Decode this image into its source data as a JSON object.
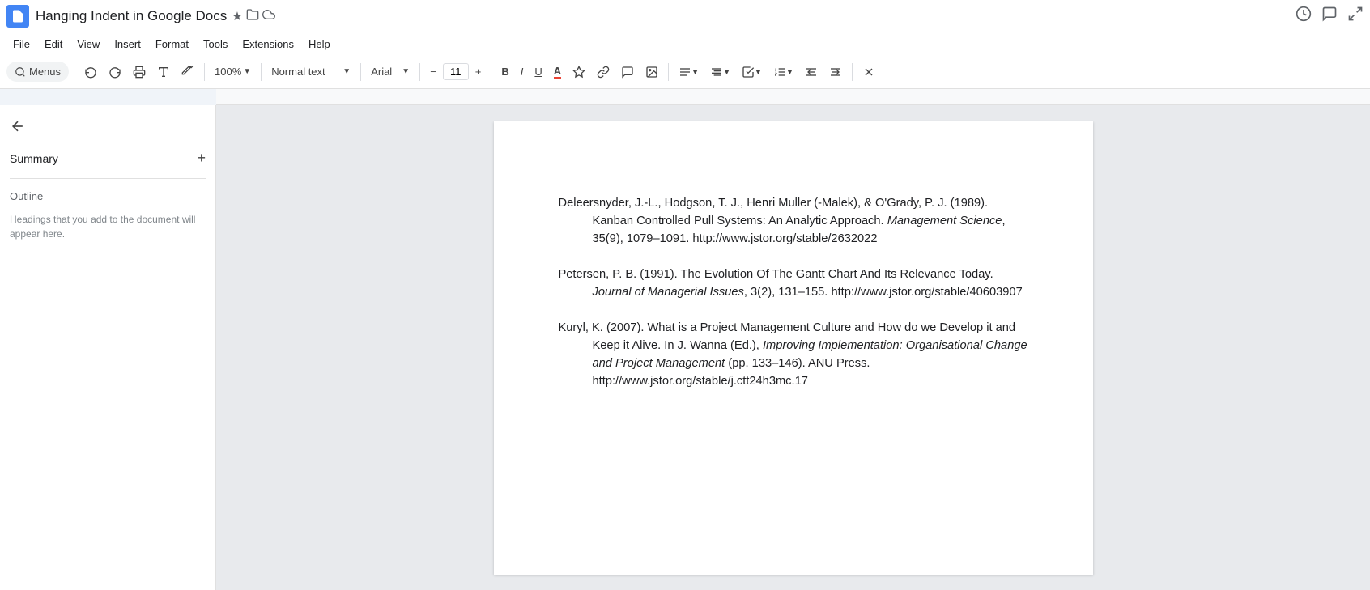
{
  "app": {
    "title": "Hanging Indent in Google Docs",
    "icon_color": "#4285f4"
  },
  "topbar": {
    "title": "Hanging Indent in Google Docs",
    "star_icon": "★",
    "folder_icon": "📁",
    "cloud_icon": "☁",
    "history_icon": "⏱",
    "comment_icon": "💬",
    "expand_icon": "⛶"
  },
  "menubar": {
    "items": [
      "File",
      "Edit",
      "View",
      "Insert",
      "Format",
      "Tools",
      "Extensions",
      "Help"
    ]
  },
  "toolbar": {
    "menus_label": "Menus",
    "undo_icon": "↩",
    "redo_icon": "↪",
    "print_icon": "🖨",
    "spell_icon": "✓",
    "paint_icon": "🖌",
    "zoom_value": "100%",
    "style_value": "Normal text",
    "font_value": "Arial",
    "font_size": "11",
    "bold_label": "B",
    "italic_label": "I",
    "underline_label": "U",
    "text_color_icon": "A",
    "highlight_icon": "✏",
    "link_icon": "🔗",
    "comment_icon": "💬",
    "image_icon": "🖼",
    "align_icon": "≡",
    "spacing_icon": "↕",
    "list1_icon": "☰",
    "list2_icon": "≡",
    "indent_dec_icon": "⇤",
    "indent_inc_icon": "⇥",
    "clear_icon": "✕"
  },
  "sidebar": {
    "back_icon": "←",
    "summary_title": "Summary",
    "add_icon": "+",
    "outline_title": "Outline",
    "outline_hint": "Headings that you add to the document will appear here."
  },
  "document": {
    "references": [
      {
        "id": 1,
        "text_parts": [
          {
            "text": "Deleersnyder, J.-L., Hodgson, T. J., Henri Muller (-Malek), & O'Grady, P. J. (1989). Kanban Controlled Pull Systems: An Analytic Approach. ",
            "italic": false
          },
          {
            "text": "Management Science",
            "italic": true
          },
          {
            "text": ", 35(9), 1079–1091. http://www.jstor.org/stable/2632022",
            "italic": false
          }
        ]
      },
      {
        "id": 2,
        "text_parts": [
          {
            "text": "Petersen, P. B. (1991). The Evolution Of The Gantt Chart And Its Relevance Today. ",
            "italic": false
          },
          {
            "text": "Journal of Managerial Issues",
            "italic": true
          },
          {
            "text": ", 3(2), 131–155. http://www.jstor.org/stable/40603907",
            "italic": false
          }
        ]
      },
      {
        "id": 3,
        "text_parts": [
          {
            "text": "Kuryl, K. (2007). What is a Project Management Culture and How do we Develop it and Keep it Alive. In J. Wanna (Ed.), ",
            "italic": false
          },
          {
            "text": "Improving Implementation: Organisational Change and Project Management",
            "italic": true
          },
          {
            "text": " (pp. 133–146). ANU Press. http://www.jstor.org/stable/j.ctt24h3mc.17",
            "italic": false
          }
        ]
      }
    ]
  }
}
